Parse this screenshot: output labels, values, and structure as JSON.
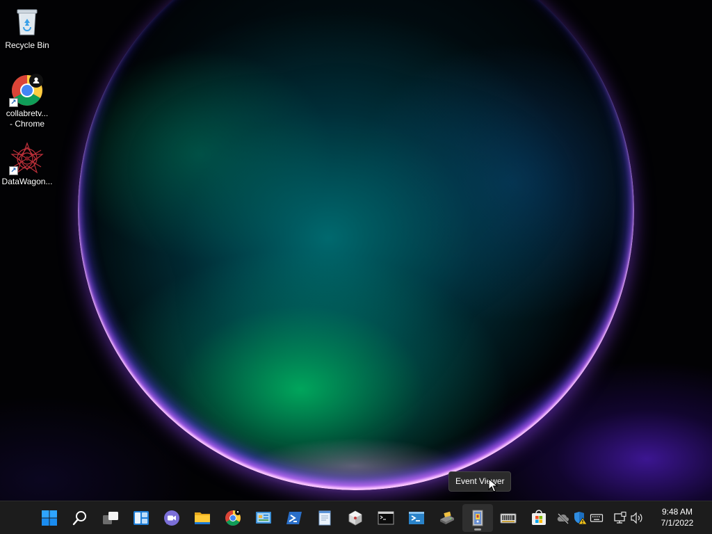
{
  "desktop": {
    "icons": [
      {
        "label": "Recycle Bin",
        "icon": "recycle-bin-icon"
      },
      {
        "label": "collabretv...\n- Chrome",
        "icon": "chrome-profile-icon"
      },
      {
        "label": "DataWagon...",
        "icon": "datawagon-icon"
      }
    ]
  },
  "tooltip": {
    "text": "Event Viewer"
  },
  "taskbar": {
    "apps": [
      {
        "name": "Start",
        "icon": "windows-start-icon"
      },
      {
        "name": "Search",
        "icon": "search-icon"
      },
      {
        "name": "Task View",
        "icon": "task-view-icon"
      },
      {
        "name": "Widgets",
        "icon": "widgets-icon"
      },
      {
        "name": "Chat",
        "icon": "teams-chat-icon"
      },
      {
        "name": "File Explorer",
        "icon": "folder-icon"
      },
      {
        "name": "Google Chrome",
        "icon": "chrome-icon"
      },
      {
        "name": "Control Panel",
        "icon": "control-panel-icon"
      },
      {
        "name": "PowerShell",
        "icon": "powershell-icon"
      },
      {
        "name": "Notepad",
        "icon": "notepad-icon"
      },
      {
        "name": "Component Services",
        "icon": "component-services-icon"
      },
      {
        "name": "Command Prompt",
        "icon": "command-prompt-icon"
      },
      {
        "name": "PowerShell ISE",
        "icon": "powershell-ise-icon"
      },
      {
        "name": "Disk Management",
        "icon": "disk-management-icon"
      },
      {
        "name": "Event Viewer",
        "icon": "event-viewer-icon",
        "active": true
      },
      {
        "name": "Device Manager",
        "icon": "device-manager-icon"
      },
      {
        "name": "Microsoft Store",
        "icon": "store-icon"
      }
    ],
    "tray": [
      {
        "name": "OneDrive",
        "icon": "cloud-offline-icon"
      },
      {
        "name": "Windows Security",
        "icon": "security-warning-icon"
      },
      {
        "name": "Touch Keyboard",
        "icon": "keyboard-icon"
      },
      {
        "name": "Network",
        "icon": "network-icon"
      },
      {
        "name": "Volume",
        "icon": "volume-icon"
      }
    ],
    "clock": {
      "time": "9:48 AM",
      "date": "7/1/2022"
    }
  },
  "colors": {
    "taskbar": "#1c1c1c",
    "tooltip_bg": "#2b2b2b",
    "accent_blue": "#0078d4"
  }
}
